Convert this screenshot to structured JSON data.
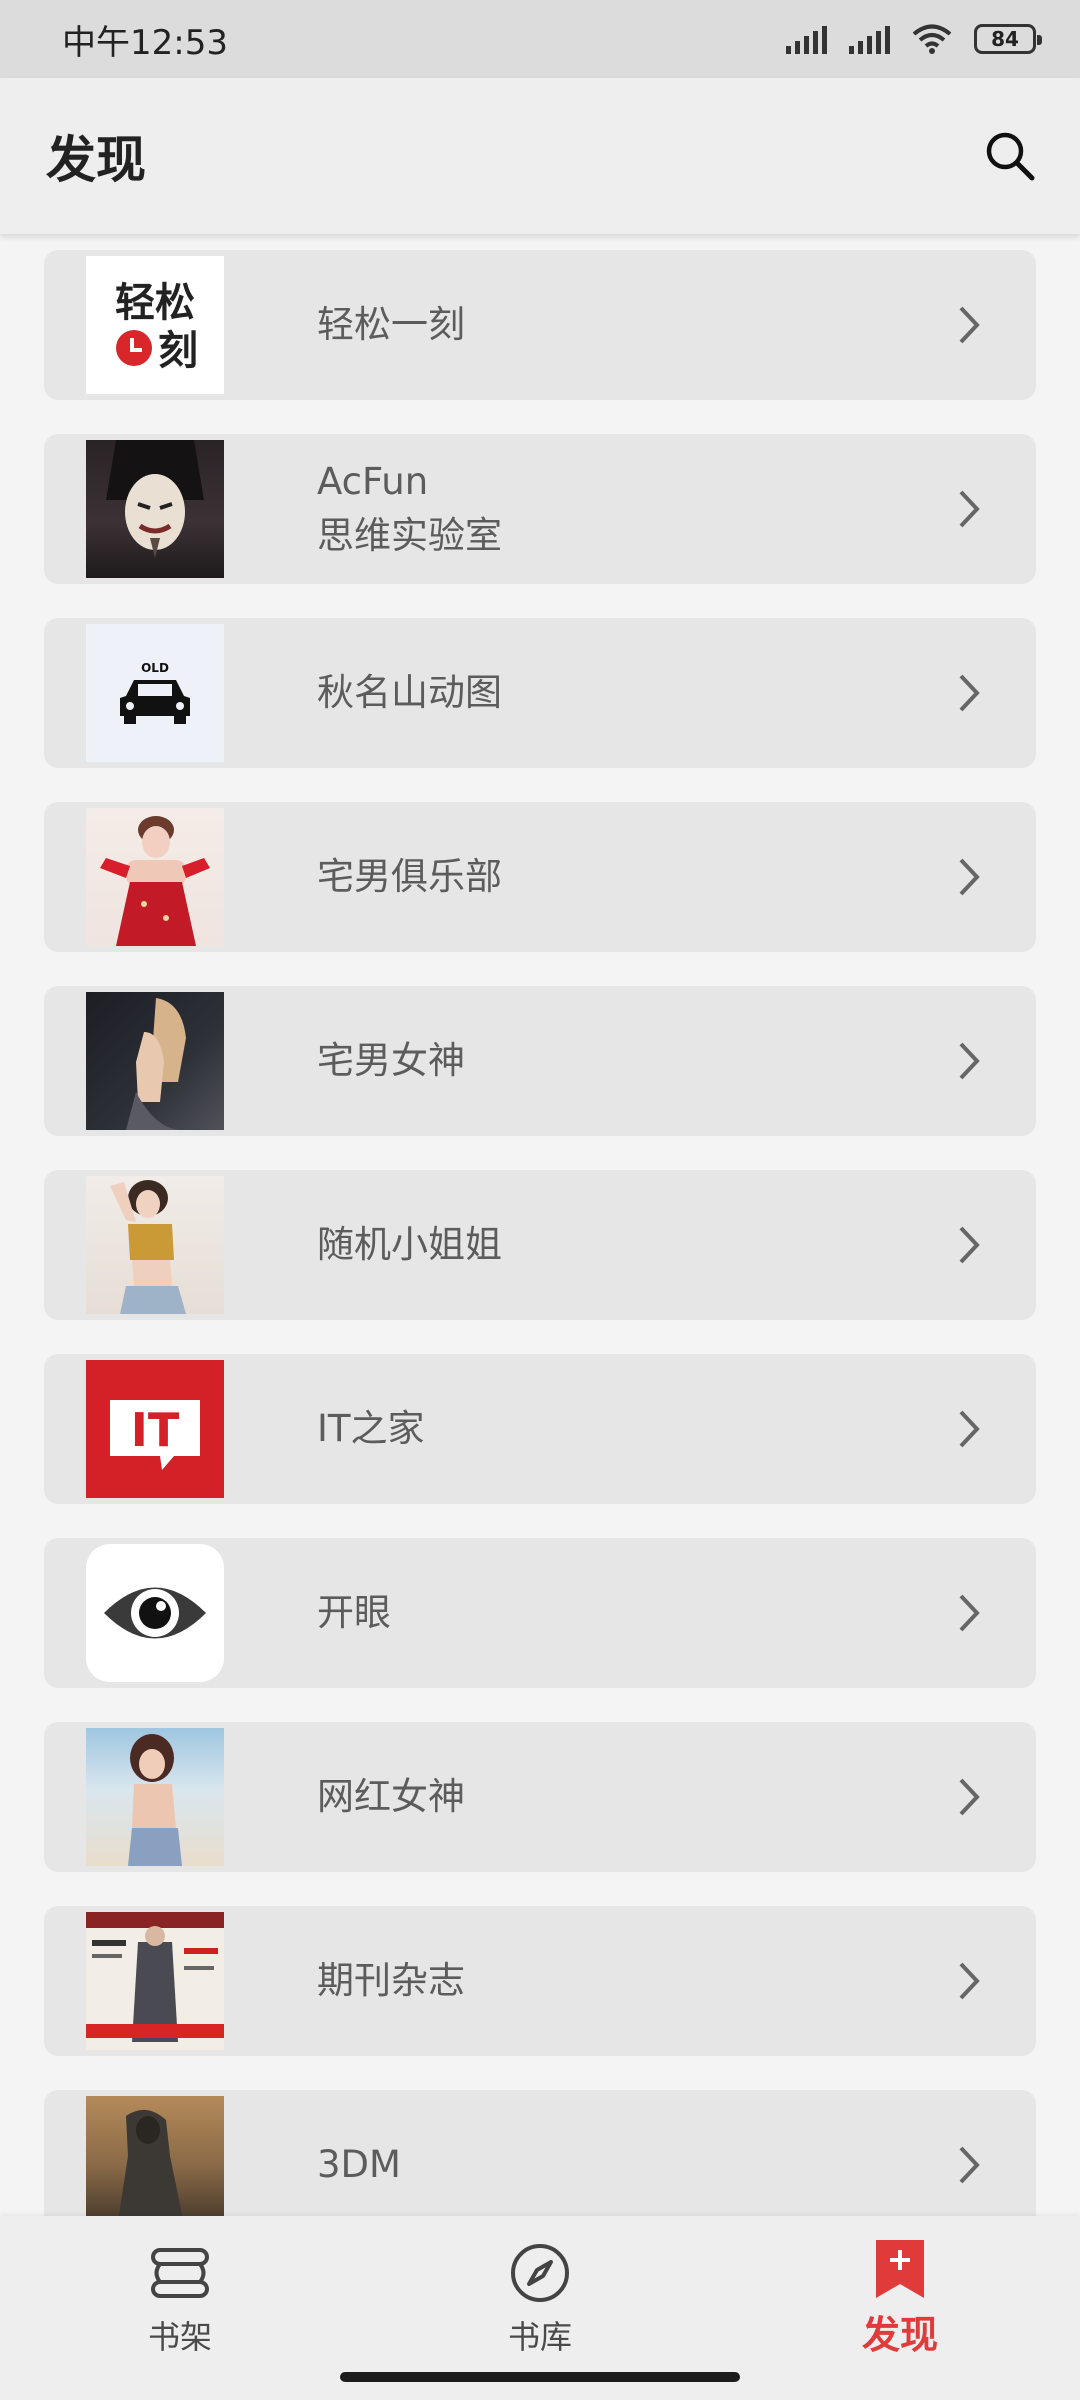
{
  "status_bar": {
    "time": "中午12:53",
    "battery": "84"
  },
  "header": {
    "title": "发现"
  },
  "items": [
    {
      "label": "轻松一刻",
      "label2": "",
      "icon": "qingsong-logo"
    },
    {
      "label": "AcFun",
      "label2": "思维实验室",
      "icon": "mask-photo"
    },
    {
      "label": "秋名山动图",
      "label2": "",
      "icon": "old-car-icon"
    },
    {
      "label": "宅男俱乐部",
      "label2": "",
      "icon": "photo"
    },
    {
      "label": "宅男女神",
      "label2": "",
      "icon": "photo"
    },
    {
      "label": "随机小姐姐",
      "label2": "",
      "icon": "photo"
    },
    {
      "label": "IT之家",
      "label2": "",
      "icon": "ithome-logo"
    },
    {
      "label": "开眼",
      "label2": "",
      "icon": "eye-logo"
    },
    {
      "label": "网红女神",
      "label2": "",
      "icon": "photo"
    },
    {
      "label": "期刊杂志",
      "label2": "",
      "icon": "magazine-cover"
    },
    {
      "label": "3DM",
      "label2": "",
      "icon": "game-art"
    }
  ],
  "logos": {
    "qingsong_text_top": "轻松",
    "qingsong_text_bottom": "刻",
    "old_car_text": "OLD",
    "ithome_text": "IT"
  },
  "bottom_nav": [
    {
      "label": "书架",
      "icon": "bookshelf-icon",
      "active": false
    },
    {
      "label": "书库",
      "icon": "compass-icon",
      "active": false
    },
    {
      "label": "发现",
      "icon": "bookmark-plus-icon",
      "active": true
    }
  ],
  "colors": {
    "accent": "#e03a3a",
    "item_bg": "#e6e6e6",
    "page_bg": "#f4f4f4"
  }
}
